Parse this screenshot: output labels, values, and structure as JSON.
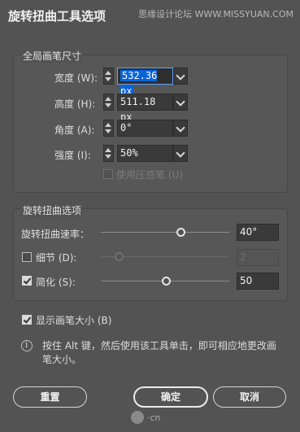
{
  "dialog": {
    "title": "旋转扭曲工具选项",
    "watermark": "思缘设计论坛 WWW.MISSYUAN.COM"
  },
  "global_brush": {
    "title": "全局画笔尺寸",
    "width": {
      "label": "宽度 (W):",
      "value": "532.36 px"
    },
    "height": {
      "label": "高度 (H):",
      "value": "511.18 px"
    },
    "angle": {
      "label": "角度 (A):",
      "value": "0°"
    },
    "intensity": {
      "label": "强度 (I):",
      "value": "50%"
    },
    "pressure": {
      "label": "使用压感笔 (U)"
    }
  },
  "twirl_options": {
    "title": "旋转扭曲选项",
    "rate": {
      "label": "旋转扭曲速率：",
      "value": "40°",
      "fraction": 0.72
    },
    "detail": {
      "label": "细节 (D):",
      "value": "2",
      "fraction": 0.09,
      "checked": false
    },
    "simplify": {
      "label": "简化 (S):",
      "value": "50",
      "fraction": 0.49,
      "checked": true
    }
  },
  "show_brush": {
    "label": "显示画笔大小 (B)",
    "checked": true
  },
  "info": {
    "text_line1": "按住 Alt 键，然后使用该工具单击，即可相应地更改画",
    "text_line2": "笔大小。"
  },
  "buttons": {
    "reset": "重置",
    "ok": "确定",
    "cancel": "取消"
  },
  "footer": {
    "logo_text": "·cn"
  }
}
